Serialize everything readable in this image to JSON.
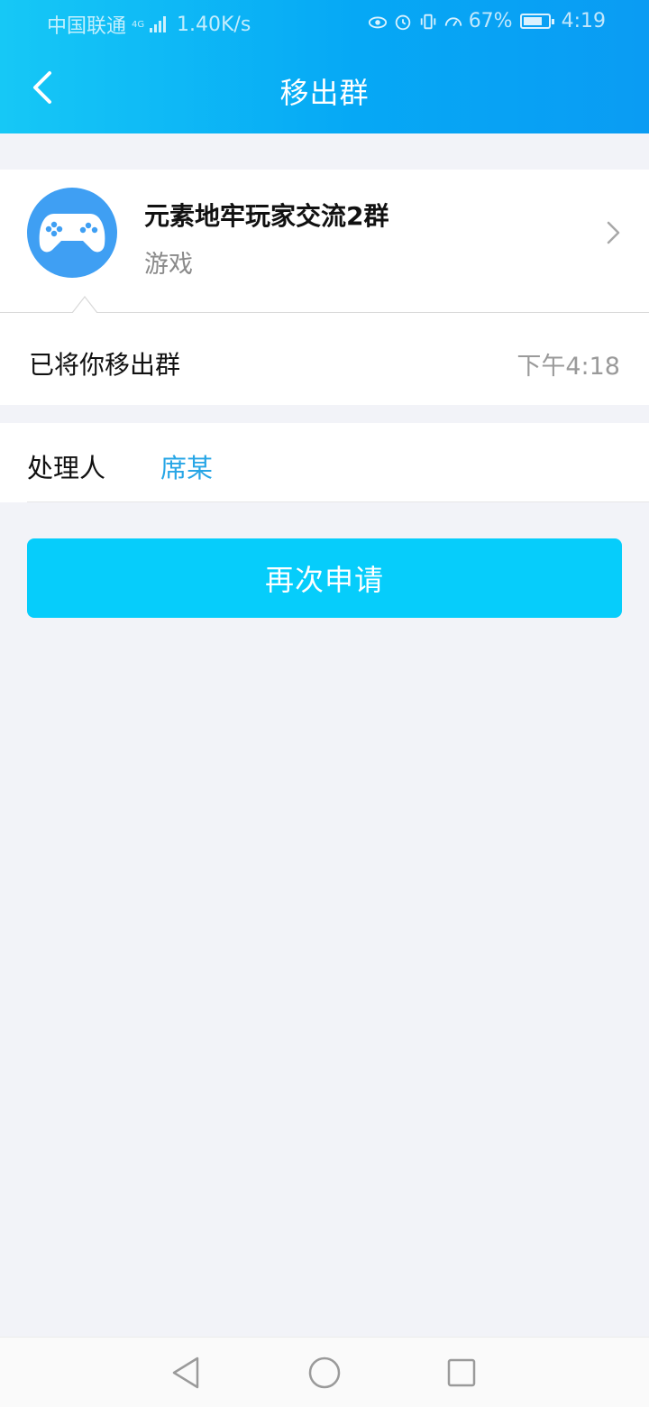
{
  "status_bar": {
    "carrier": "中国联通",
    "network_badge": "4G",
    "speed": "1.40K/s",
    "battery": "67%",
    "time": "4:19",
    "icons": [
      "eye-icon",
      "alarm-icon",
      "vibrate-icon",
      "speed-gauge-icon",
      "battery-icon"
    ]
  },
  "header": {
    "title": "移出群",
    "back_icon": "chevron-left-icon"
  },
  "group": {
    "name": "元素地牢玩家交流2群",
    "category": "游戏",
    "avatar_icon": "gamepad-icon",
    "avatar_color": "#3f9ff3"
  },
  "notice": {
    "message": "已将你移出群",
    "time": "下午4:18"
  },
  "handler": {
    "label": "处理人",
    "name": "席某",
    "name_color": "#27a6e6"
  },
  "actions": {
    "reapply_label": "再次申请",
    "button_color": "#06cdfb"
  },
  "nav_bar": {
    "icons": [
      "back-triangle-icon",
      "home-circle-icon",
      "recents-square-icon"
    ]
  },
  "colors": {
    "header_gradient_start": "#16c8f6",
    "header_gradient_end": "#0a9cf3",
    "page_background": "#f2f3f8"
  }
}
